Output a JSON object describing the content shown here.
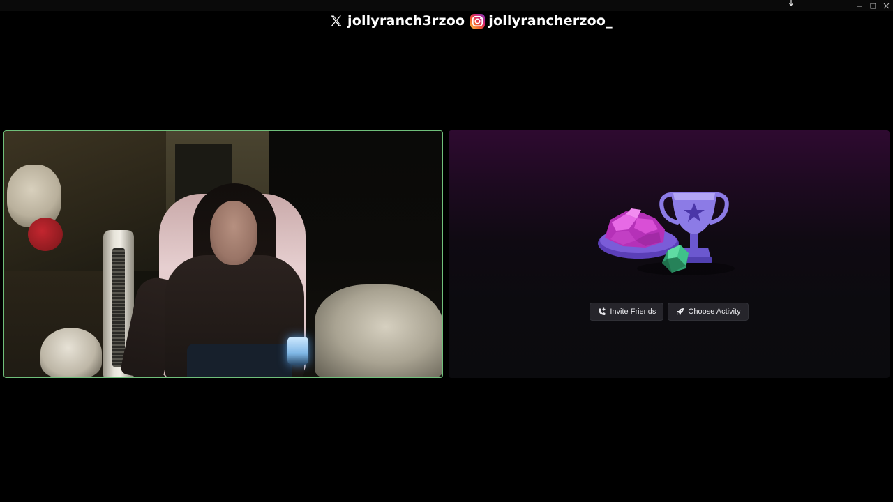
{
  "socials": {
    "x_handle": "jollyranch3rzoo",
    "instagram_handle": "jollyrancherzoo_"
  },
  "icons": {
    "x": "x-logo-icon",
    "instagram": "instagram-logo-icon",
    "invite": "phone-add-icon",
    "activity": "rocket-icon",
    "minimize": "minimize-icon",
    "maximize": "maximize-icon",
    "close": "close-icon"
  },
  "activity_panel": {
    "invite_label": "Invite Friends",
    "choose_label": "Choose Activity"
  },
  "colors": {
    "speaking_border": "#6fbf7a",
    "activity_gradient_top": "#2e0a30",
    "activity_gradient_bottom": "#0b0b0e",
    "button_bg": "#26252b",
    "trophy": "#8c7be6",
    "gem_pink": "#d94fd6",
    "gem_green": "#3fc28a"
  }
}
